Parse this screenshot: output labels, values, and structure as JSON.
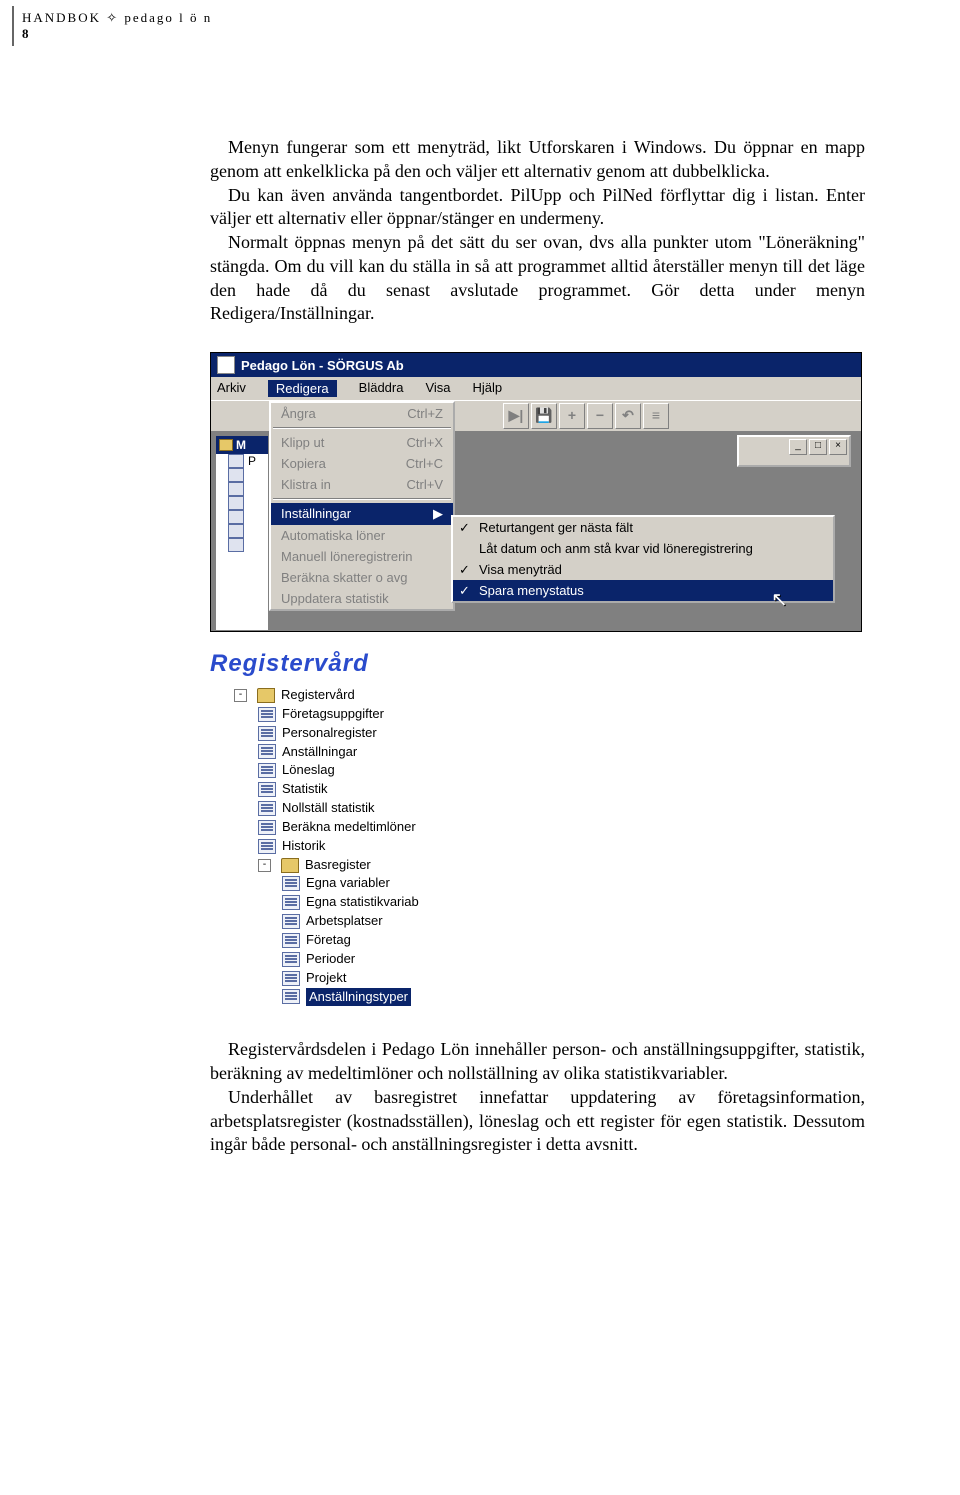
{
  "header": {
    "line": "HANDBOK ✧ pedago l ö n",
    "page": "8"
  },
  "para1": "Menyn fungerar som ett menyträd, likt Utforskaren i Windows. Du öppnar en mapp genom att enkelklicka på den och väljer ett alternativ genom att dubbelklicka.",
  "para2": "Du kan även använda tangentbordet. PilUpp och PilNed förflyttar dig i listan. Enter väljer ett alternativ eller öppnar/stänger en undermeny.",
  "para3": "Normalt öppnas menyn på det sätt du ser ovan, dvs alla punkter utom \"Löneräkning\" stängda. Om du vill kan du ställa in så att programmet alltid återställer menyn till det läge den hade då du senast avslutade programmet. Gör detta under menyn Redigera/Inställningar.",
  "sectionTitle": "Registervård",
  "para4": "Registervårdsdelen i Pedago Lön innehåller person- och anställningsuppgifter, statistik, beräkning av medeltimlöner och nollställning av olika statistikvariabler.",
  "para5": "Underhållet av basregistret innefattar uppdatering av företagsinformation, arbetsplatsregister (kostnadsställen), löneslag och ett register för egen statistik. Dessutom ingår både personal- och anställningsregister i detta avsnitt.",
  "shot1": {
    "title": "Pedago Lön - SÖRGUS Ab",
    "menubar": [
      "Arkiv",
      "Redigera",
      "Bläddra",
      "Visa",
      "Hjälp"
    ],
    "tbtn": [
      "▶|",
      "💾",
      "+",
      "−",
      "↶",
      "≡"
    ],
    "drop": [
      {
        "l": "Ångra",
        "r": "Ctrl+Z"
      },
      {
        "sep": true
      },
      {
        "l": "Klipp ut",
        "r": "Ctrl+X"
      },
      {
        "l": "Kopiera",
        "r": "Ctrl+C"
      },
      {
        "l": "Klistra in",
        "r": "Ctrl+V"
      },
      {
        "sep": true
      },
      {
        "l": "Inställningar",
        "arrow": "▶",
        "sel": true
      },
      {
        "l": "Automatiska löner"
      },
      {
        "l": "Manuell löneregistrerin"
      },
      {
        "l": "Beräkna skatter o avg"
      },
      {
        "l": "Uppdatera statistik"
      }
    ],
    "sub": [
      {
        "l": "Returtangent ger nästa fält",
        "chk": true
      },
      {
        "l": "Låt datum och anm stå kvar vid löneregistrering"
      },
      {
        "l": "Visa menyträd",
        "chk": true
      },
      {
        "l": "Spara menystatus",
        "chk": true,
        "sel": true
      }
    ],
    "side": [
      "M",
      "P"
    ]
  },
  "tree": [
    {
      "type": "folder",
      "label": "Registervård",
      "indent": 1,
      "exp": "-"
    },
    {
      "type": "doc",
      "label": "Företagsuppgifter",
      "indent": 2
    },
    {
      "type": "doc",
      "label": "Personalregister",
      "indent": 2
    },
    {
      "type": "doc",
      "label": "Anställningar",
      "indent": 2
    },
    {
      "type": "doc",
      "label": "Löneslag",
      "indent": 2
    },
    {
      "type": "doc",
      "label": "Statistik",
      "indent": 2
    },
    {
      "type": "doc",
      "label": "Nollställ statistik",
      "indent": 2
    },
    {
      "type": "doc",
      "label": "Beräkna medeltimlöner",
      "indent": 2
    },
    {
      "type": "doc",
      "label": "Historik",
      "indent": 2
    },
    {
      "type": "folder",
      "label": "Basregister",
      "indent": 2,
      "exp": "-"
    },
    {
      "type": "doc",
      "label": "Egna variabler",
      "indent": 3
    },
    {
      "type": "doc",
      "label": "Egna statistikvariab",
      "indent": 3
    },
    {
      "type": "doc",
      "label": "Arbetsplatser",
      "indent": 3
    },
    {
      "type": "doc",
      "label": "Företag",
      "indent": 3
    },
    {
      "type": "doc",
      "label": "Perioder",
      "indent": 3
    },
    {
      "type": "doc",
      "label": "Projekt",
      "indent": 3
    },
    {
      "type": "doc",
      "label": "Anställningstyper",
      "indent": 3,
      "sel": true
    }
  ]
}
